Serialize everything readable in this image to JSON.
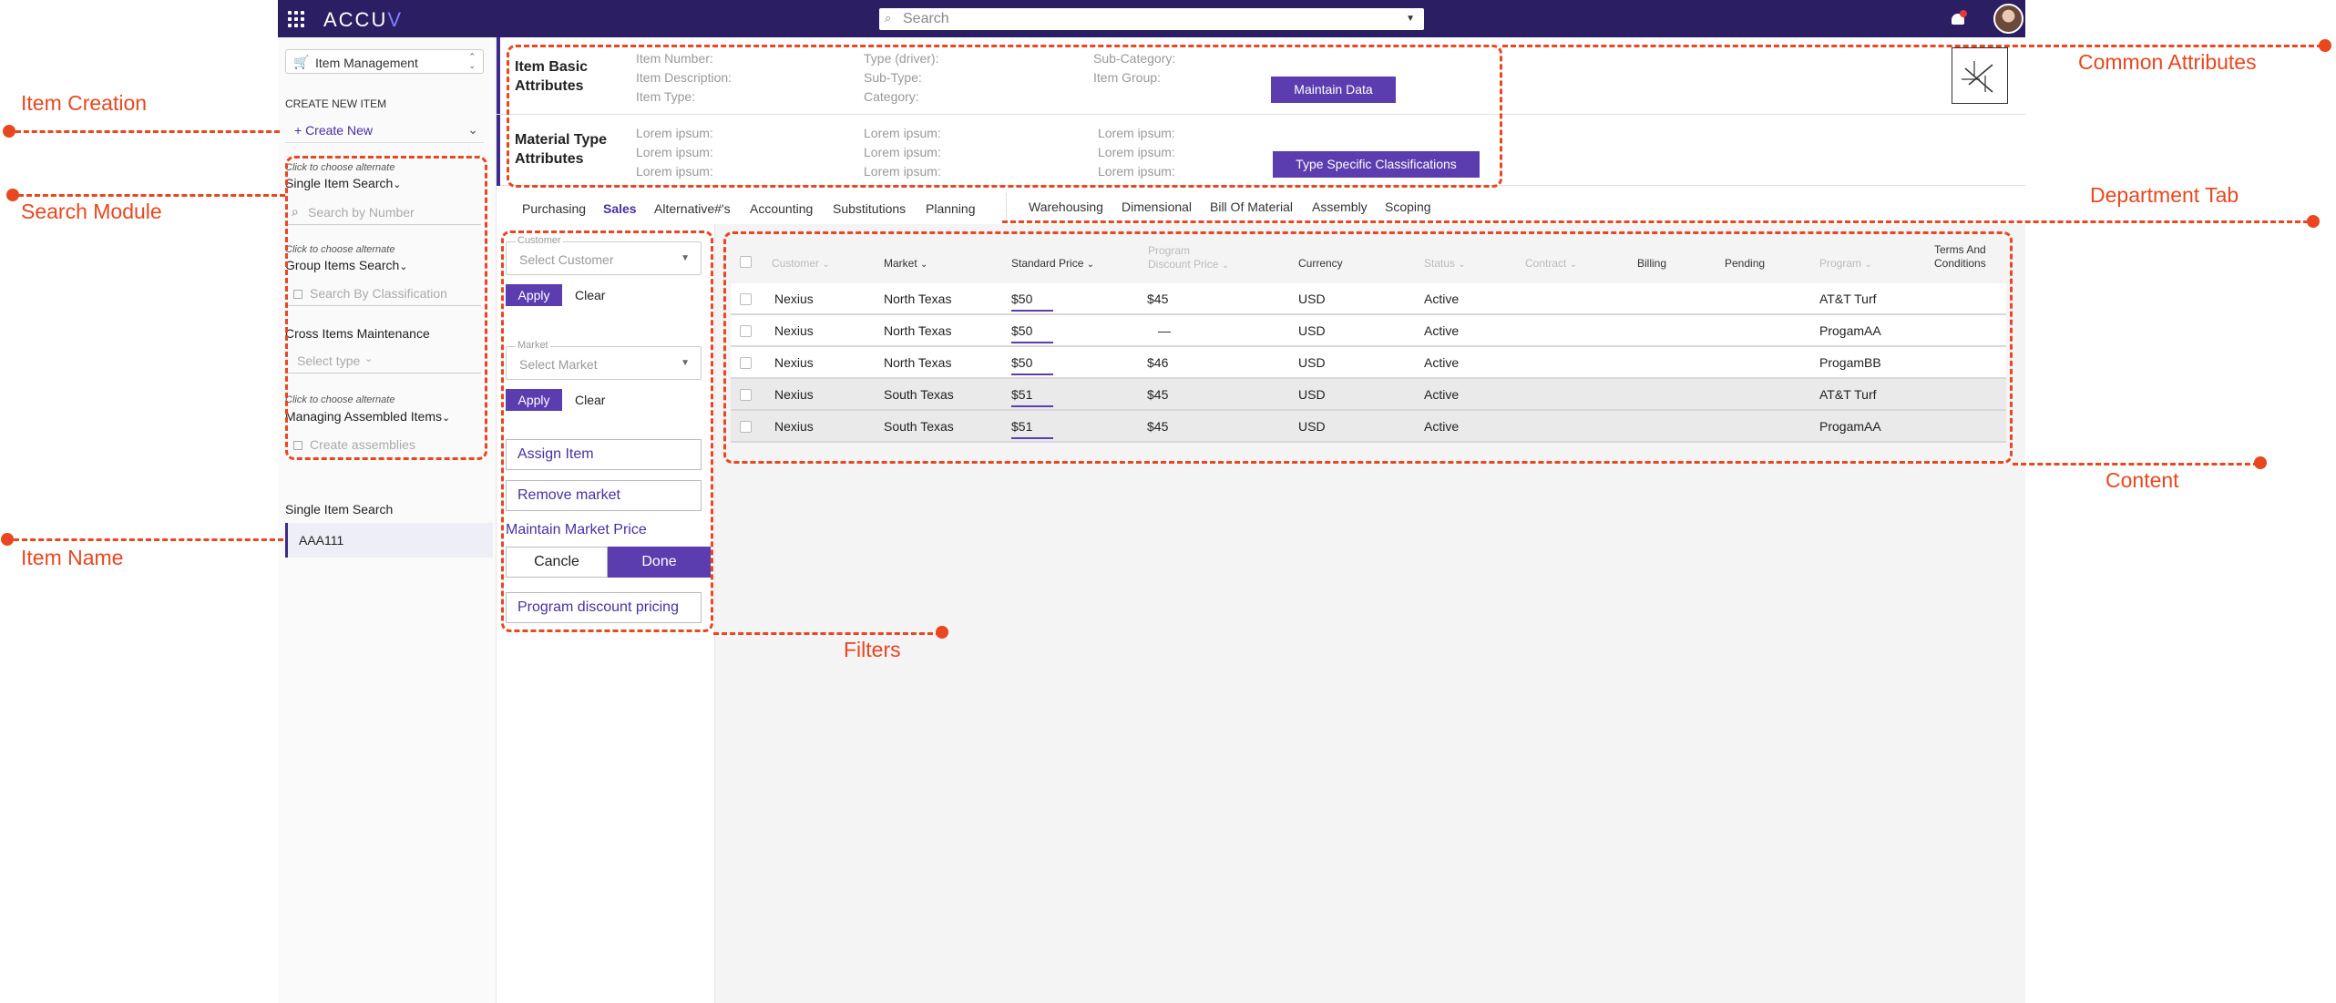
{
  "app": {
    "logo_text": "ACCU",
    "logo_accent": "V",
    "search_placeholder": "Search",
    "module": "Item Management"
  },
  "sidebar": {
    "create_heading": "CREATE NEW ITEM",
    "create_new": "+ Create New",
    "hint1": "Click to choose alternate",
    "single_search": "Single Item Search",
    "search_number_ph": "Search by Number",
    "hint2": "Click to choose alternate",
    "group_search": "Group Items Search",
    "search_class_ph": "Search By Classification",
    "cross_maint": "Cross Items Maintenance",
    "select_type_ph": "Select type",
    "hint3": "Click to choose alternate",
    "managing_assembled": "Managing Assembled Items",
    "create_assemblies": "Create assemblies",
    "single_item_search_label": "Single Item Search",
    "item_value": "AAA111"
  },
  "header": {
    "basic_title_1": "Item Basic",
    "basic_title_2": "Attributes",
    "basic_attrs": [
      "Item Number:",
      "Item Description:",
      "Item Type:",
      "Type (driver):",
      "Sub-Type:",
      "Category:",
      "Sub-Category:",
      "Item Group:"
    ],
    "maintain_btn": "Maintain Data",
    "material_title_1": "Material Type",
    "material_title_2": "Attributes",
    "lorem": "Lorem ipsum:",
    "type_specific_btn": "Type Specific Classifications"
  },
  "tabs": [
    "Purchasing",
    "Sales",
    "Alternative#'s",
    "Accounting",
    "Substitutions",
    "Planning",
    "Warehousing",
    "Dimensional",
    "Bill Of Material",
    "Assembly",
    "Scoping"
  ],
  "active_tab": "Sales",
  "filters": {
    "customer_legend": "Customer",
    "customer_ph": "Select Customer",
    "apply": "Apply",
    "clear": "Clear",
    "market_legend": "Market",
    "market_ph": "Select Market",
    "assign_item": "Assign Item",
    "remove_market": "Remove market",
    "maintain_market_price": "Maintain Market Price",
    "cancel": "Cancle",
    "done": "Done",
    "program_discount": "Program discount pricing"
  },
  "table": {
    "headers": {
      "customer": "Customer",
      "market": "Market",
      "standard_price": "Standard Price",
      "program_discount_1": "Program",
      "program_discount_2": "Discount Price",
      "currency": "Currency",
      "status": "Status",
      "contract": "Contract",
      "billing": "Billing",
      "pending": "Pending",
      "program": "Program",
      "terms_1": "Terms And",
      "terms_2": "Conditions"
    },
    "rows": [
      {
        "customer": "Nexius",
        "market": "North Texas",
        "price": "$50",
        "discount": "$45",
        "currency": "USD",
        "status": "Active",
        "program": "AT&T Turf"
      },
      {
        "customer": "Nexius",
        "market": "North Texas",
        "price": "$50",
        "discount": "—",
        "currency": "USD",
        "status": "Active",
        "program": "ProgamAA"
      },
      {
        "customer": "Nexius",
        "market": "North Texas",
        "price": "$50",
        "discount": "$46",
        "currency": "USD",
        "status": "Active",
        "program": "ProgamBB"
      },
      {
        "customer": "Nexius",
        "market": "South Texas",
        "price": "$51",
        "discount": "$45",
        "currency": "USD",
        "status": "Active",
        "program": "AT&T Turf"
      },
      {
        "customer": "Nexius",
        "market": "South Texas",
        "price": "$51",
        "discount": "$45",
        "currency": "USD",
        "status": "Active",
        "program": "ProgamAA"
      }
    ]
  },
  "annotations": {
    "item_creation": "Item Creation",
    "search_module": "Search Module",
    "item_name": "Item Name",
    "common_attributes": "Common Attributes",
    "department_tab": "Department Tab",
    "content": "Content",
    "filters": "Filters"
  },
  "colors": {
    "topbar": "#2c1e63",
    "primary": "#5b3db0",
    "annotation": "#e8471f"
  }
}
